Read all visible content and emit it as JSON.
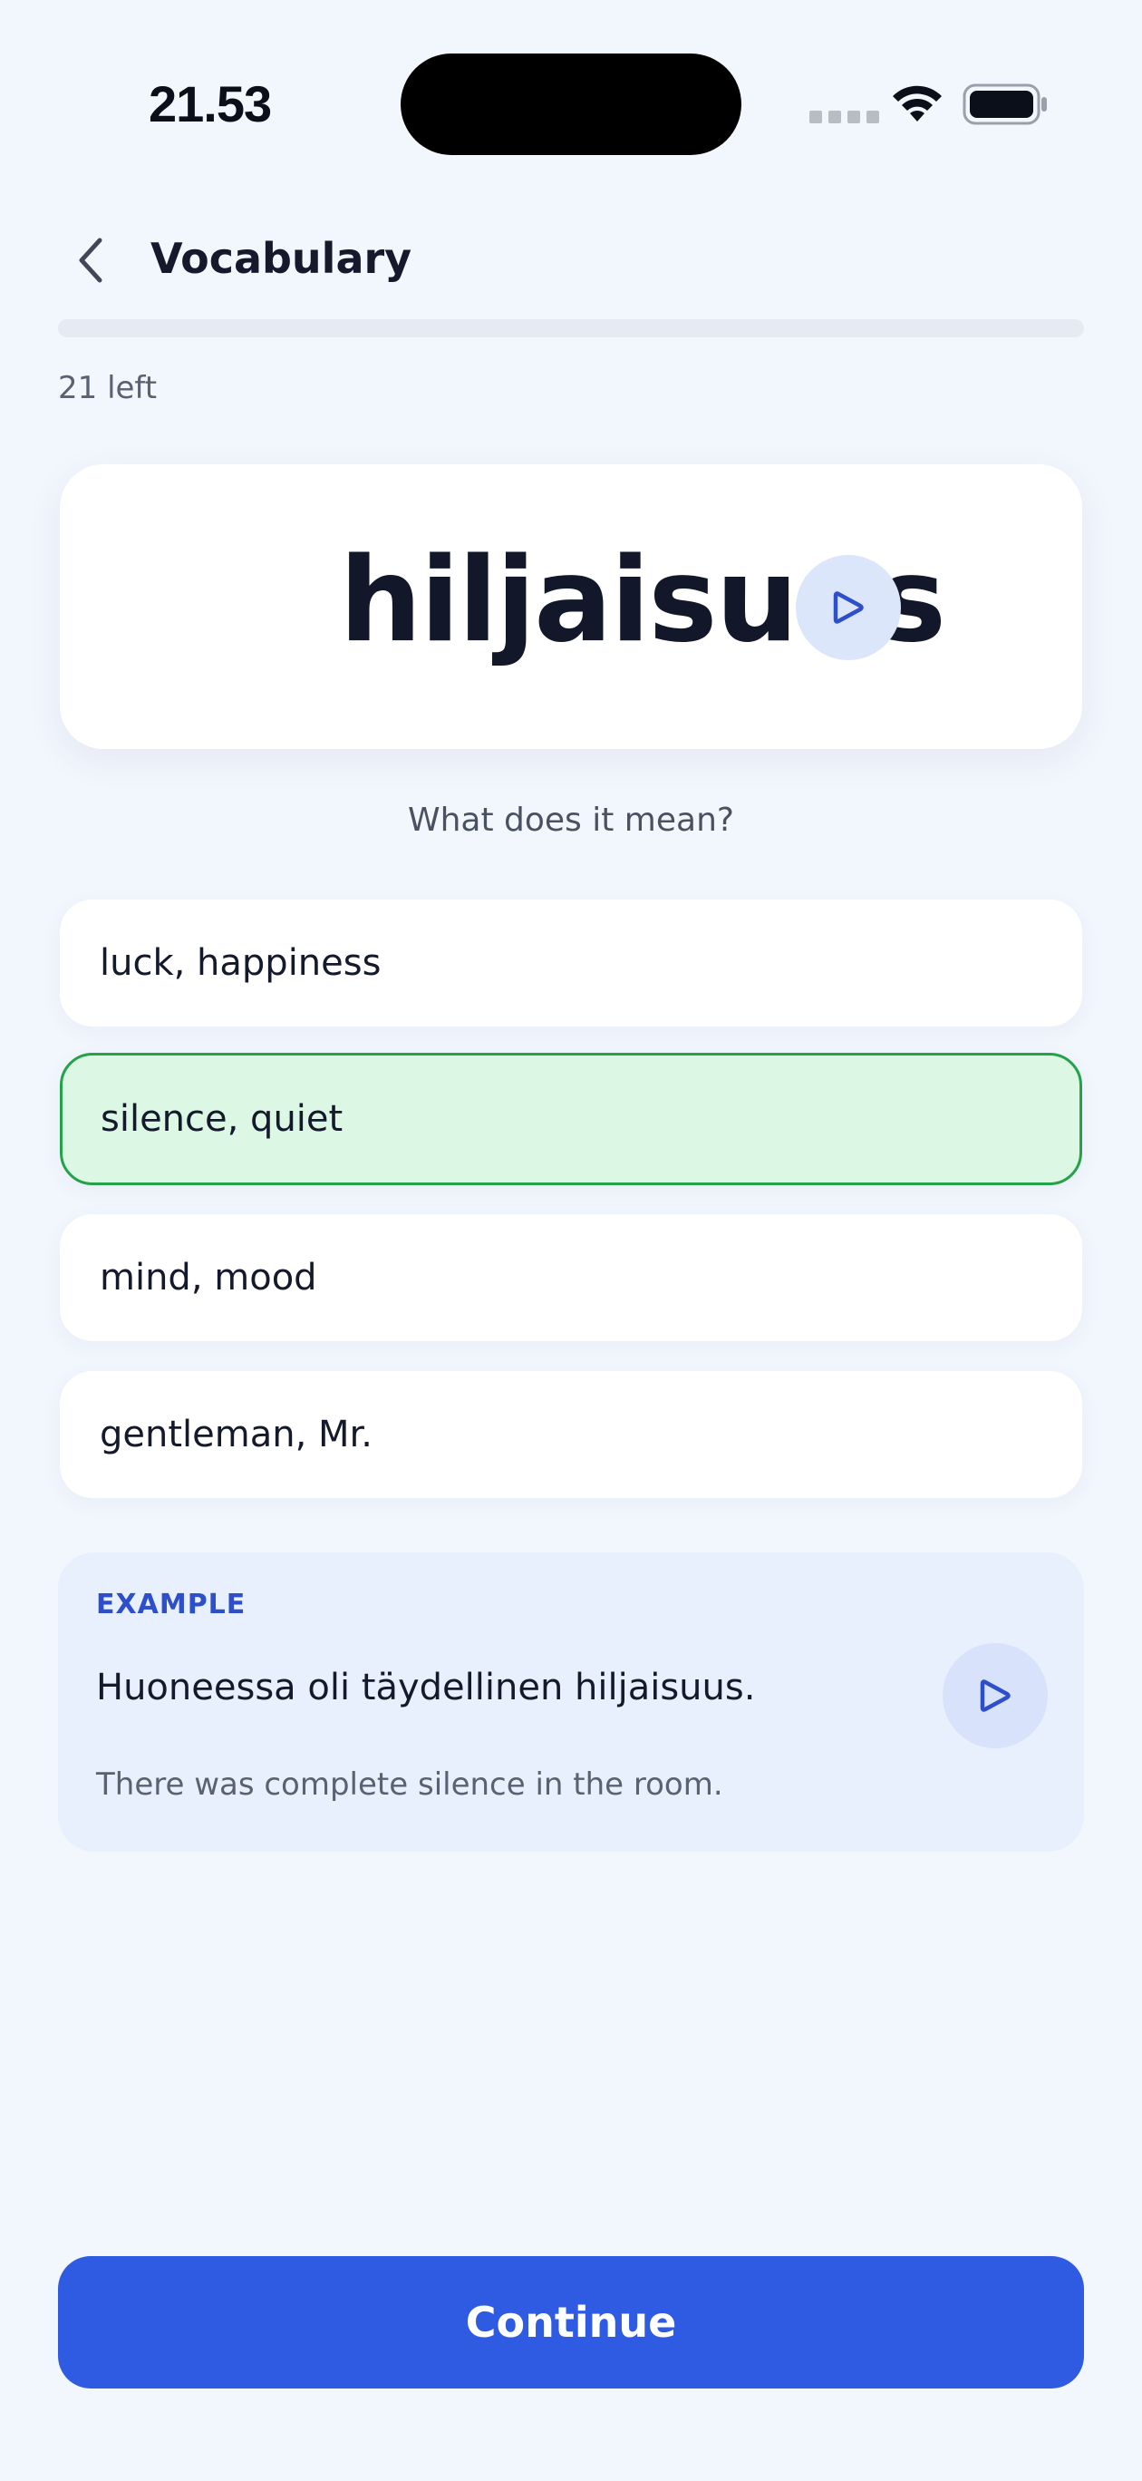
{
  "status_bar": {
    "time": "21.53"
  },
  "header": {
    "title": "Vocabulary",
    "back_icon": "chevron-left-icon"
  },
  "progress": {
    "fraction": 0,
    "remaining_label": "21 left"
  },
  "word_card": {
    "word": "hiljaisuus",
    "audio_icon": "play-icon"
  },
  "question": "What does it mean?",
  "options": [
    {
      "label": "luck, happiness",
      "state": "default"
    },
    {
      "label": "silence, quiet",
      "state": "correct"
    },
    {
      "label": "mind, mood",
      "state": "default"
    },
    {
      "label": "gentleman, Mr.",
      "state": "default"
    }
  ],
  "example": {
    "label": "EXAMPLE",
    "sentence": "Huoneessa oli täydellinen hiljaisuus.",
    "translation": "There was complete silence in the room.",
    "audio_icon": "play-icon"
  },
  "continue_label": "Continue",
  "colors": {
    "background": "#F2F6FD",
    "accent": "#2F5BE3",
    "correct_bg": "#DCF7E3",
    "correct_border": "#23A24A"
  }
}
